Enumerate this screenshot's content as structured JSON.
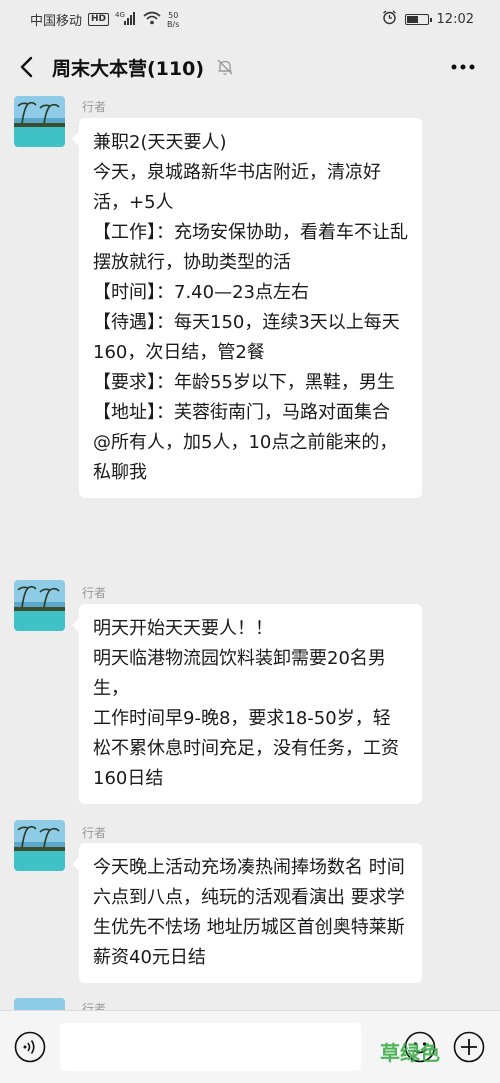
{
  "status_bar": {
    "carrier": "中国移动",
    "hd": "HD",
    "signal_type": "4G",
    "net_speed_value": "50",
    "net_speed_unit": "B/s",
    "time": "12:02",
    "battery_level": 0.6
  },
  "header": {
    "title": "周末大本营(110)",
    "icons": [
      "back-arrow-icon",
      "mute-bell-icon",
      "more-dots-icon"
    ]
  },
  "messages": [
    {
      "sender": "行者",
      "text": "兼职2(天天要人)\n今天，泉城路新华书店附近，清凉好活，+5人\n【工作】：充场安保协助，看着车不让乱摆放就行，协助类型的活\n【时间】：7.40—23点左右\n【待遇】：每天150，连续3天以上每天160，次日结，管2餐\n【要求】：年龄55岁以下，黑鞋，男生\n【地址】：芙蓉街南门，马路对面集合\n@所有人，加5人，10点之前能来的，私聊我"
    },
    {
      "sender": "行者",
      "text": "明天开始天天要人！！\n明天临港物流园饮料装卸需要20名男生，\n工作时间早9-晚8，要求18-50岁，轻松不累休息时间充足，没有任务，工资160日结"
    },
    {
      "sender": "行者",
      "text": "今天晚上活动充场凑热闹捧场数名 时间六点到八点，纯玩的活观看演出 要求学生优先不怯场 地址历城区首创奥特莱斯 薪资40元日结"
    },
    {
      "sender": "行者",
      "text": ""
    }
  ],
  "input_bar": {
    "placeholder": "",
    "watermark": "草绿色",
    "icons": [
      "voice-icon",
      "emoji-icon",
      "add-icon"
    ]
  },
  "colors": {
    "background": "#ededed",
    "bubble": "#ffffff",
    "watermark": "#3cae4a"
  }
}
